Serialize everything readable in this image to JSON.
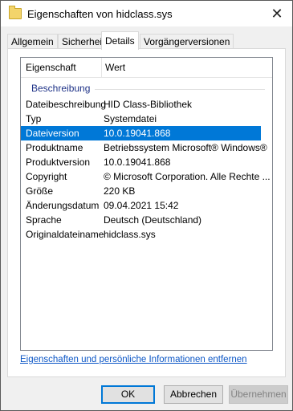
{
  "window": {
    "title": "Eigenschaften von hidclass.sys",
    "close_glyph": "✕"
  },
  "tabs": [
    {
      "label": "Allgemein"
    },
    {
      "label": "Sicherheit"
    },
    {
      "label": "Details",
      "active": true
    },
    {
      "label": "Vorgängerversionen"
    }
  ],
  "list": {
    "header": {
      "property": "Eigenschaft",
      "value": "Wert"
    },
    "group": "Beschreibung",
    "rows": [
      {
        "property": "Dateibeschreibung",
        "value": "HID Class-Bibliothek"
      },
      {
        "property": "Typ",
        "value": "Systemdatei"
      },
      {
        "property": "Dateiversion",
        "value": "10.0.19041.868",
        "selected": true
      },
      {
        "property": "Produktname",
        "value": "Betriebssystem Microsoft® Windows®"
      },
      {
        "property": "Produktversion",
        "value": "10.0.19041.868"
      },
      {
        "property": "Copyright",
        "value": "© Microsoft Corporation. Alle Rechte ..."
      },
      {
        "property": "Größe",
        "value": "220 KB"
      },
      {
        "property": "Änderungsdatum",
        "value": "09.04.2021 15:42"
      },
      {
        "property": "Sprache",
        "value": "Deutsch (Deutschland)"
      },
      {
        "property": "Originaldateiname",
        "value": "hidclass.sys"
      }
    ]
  },
  "link": "Eigenschaften und persönliche Informationen entfernen",
  "buttons": {
    "ok": "OK",
    "cancel": "Abbrechen",
    "apply": "Übernehmen"
  },
  "colors": {
    "selection": "#0078d7",
    "group_label": "#1e3287",
    "link": "#0b56c6"
  }
}
